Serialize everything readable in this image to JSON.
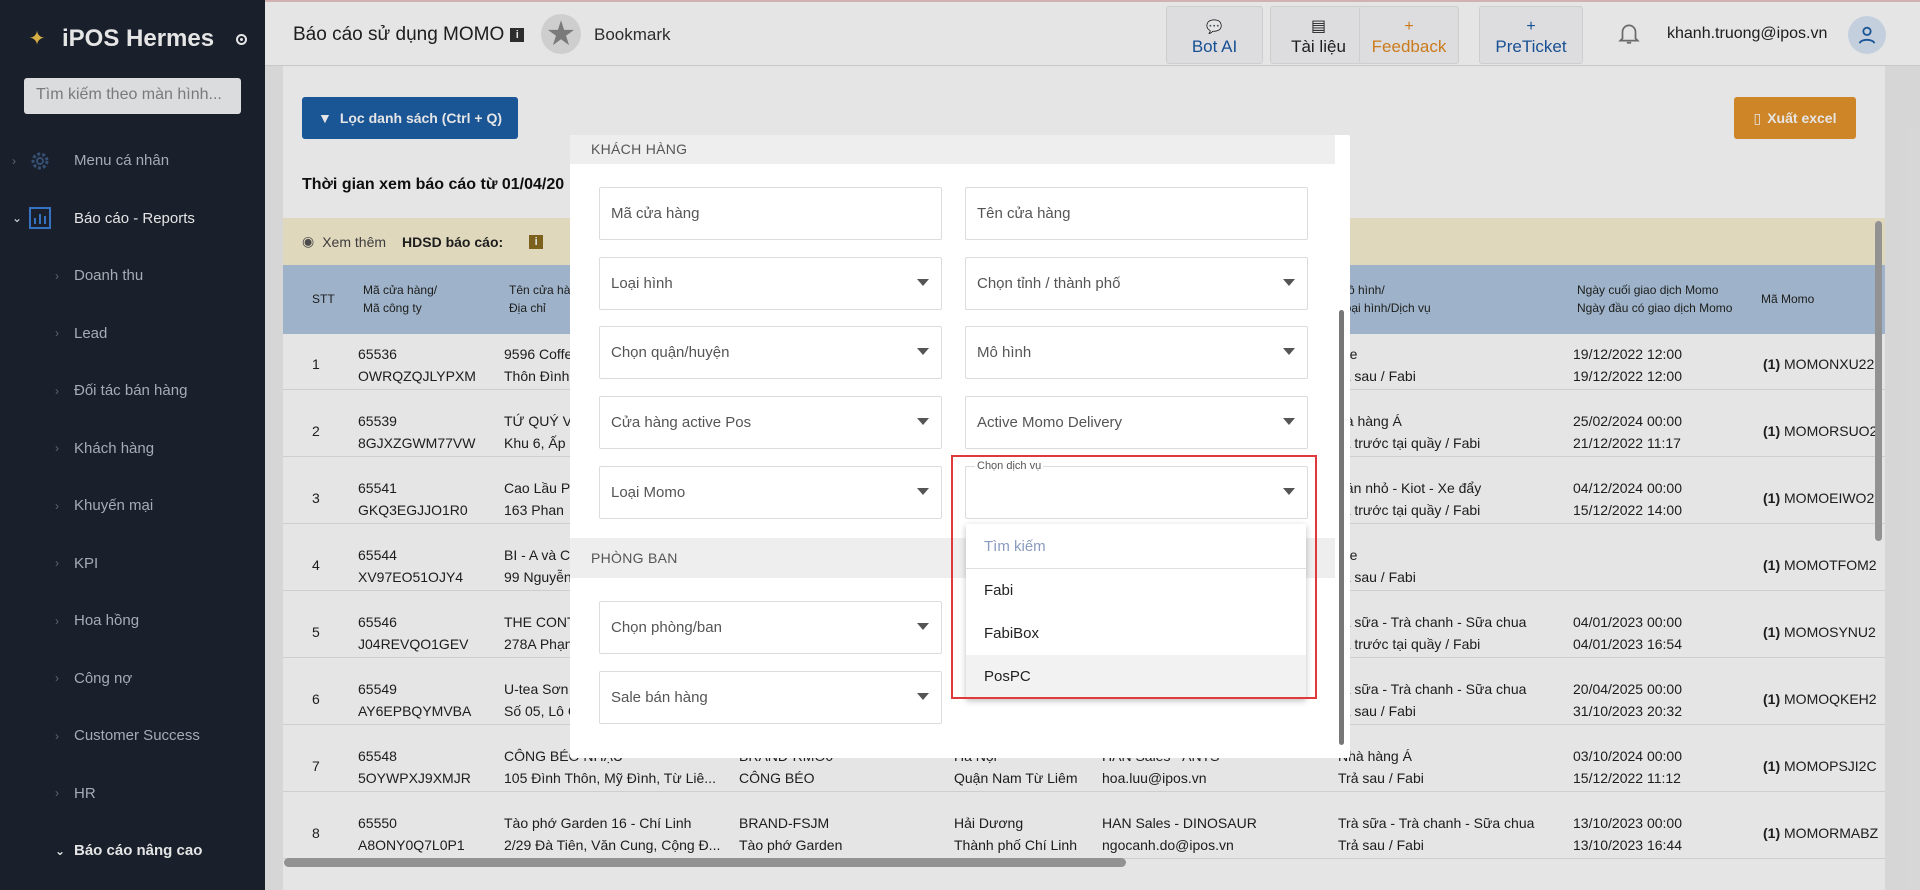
{
  "app": {
    "name": "iPOS Hermes"
  },
  "sidebar": {
    "search_placeholder": "Tìm kiếm theo màn hình...",
    "top_items": [
      {
        "label": "Menu cá nhân"
      },
      {
        "label": "Báo cáo - Reports"
      }
    ],
    "sub_items": [
      {
        "label": "Doanh thu"
      },
      {
        "label": "Lead"
      },
      {
        "label": "Đối tác bán hàng"
      },
      {
        "label": "Khách hàng"
      },
      {
        "label": "Khuyến mại"
      },
      {
        "label": "KPI"
      },
      {
        "label": "Hoa hồng"
      },
      {
        "label": "Công nợ"
      },
      {
        "label": "Customer Success"
      },
      {
        "label": "HR"
      },
      {
        "label": "Báo cáo nâng cao"
      }
    ]
  },
  "header": {
    "title": "Báo cáo sử dụng MOMO",
    "info_icon": "i",
    "bookmark_label": "Bookmark",
    "buttons": [
      {
        "label": "Bot AI",
        "icon": "chat-icon",
        "glyph": "💬"
      },
      {
        "label": "Tài liệu",
        "icon": "book-icon",
        "glyph": "📖"
      },
      {
        "label": "Feedback",
        "icon": "plus-icon",
        "glyph": "+"
      },
      {
        "label": "PreTicket",
        "icon": "plus-icon",
        "glyph": "+"
      }
    ],
    "user_email": "khanh.truong@ipos.vn"
  },
  "toolbar": {
    "filter_label": "Lọc danh sách (Ctrl + Q)",
    "export_label": "Xuất excel"
  },
  "report": {
    "time_text": "Thời gian xem báo cáo từ 01/04/20",
    "note_more": "Xem thêm",
    "note_guide": "HDSD báo cáo:",
    "note_icon": "i"
  },
  "table": {
    "columns": [
      {
        "line1": "STT",
        "line2": ""
      },
      {
        "line1": "Mã cửa hàng/",
        "line2": "Mã công ty"
      },
      {
        "line1": "Tên cửa hàn",
        "line2": "Địa chỉ"
      },
      {
        "line1": "Mô hình/",
        "line2": "Loại hình/Dịch vụ"
      },
      {
        "line1": "Ngày cuối giao dịch Momo",
        "line2": "Ngày đầu có giao dịch Momo"
      },
      {
        "line1": "Mã Momo",
        "line2": ""
      }
    ],
    "rows": [
      {
        "stt": "1",
        "code": "65536",
        "company": "OWRQZQJLYPXM",
        "name": "9596 Coffe",
        "address": "Thôn Đình",
        "brand": "",
        "brand_name": "",
        "city": "",
        "district": "",
        "sale": "",
        "sale_email": "",
        "model": "afe",
        "service": "rả sau / Fabi",
        "last": "19/12/2022 12:00",
        "first": "19/12/2022 12:00",
        "momo": "MOMONXU22"
      },
      {
        "stt": "2",
        "code": "65539",
        "company": "8GJXZGWM77VW",
        "name": "TỨ QUÝ VI",
        "address": "Khu 6, Ấp",
        "brand": "",
        "brand_name": "",
        "city": "",
        "district": "",
        "sale": "",
        "sale_email": "",
        "model": "hà hàng Á",
        "service": "rả trước tại quầy / Fabi",
        "last": "25/02/2024 00:00",
        "first": "21/12/2022 11:17",
        "momo": "MOMORSUO2"
      },
      {
        "stt": "3",
        "code": "65541",
        "company": "GKQ3EGJJO1R0",
        "name": "Cao Lầu P",
        "address": "163 Phan",
        "brand": "",
        "brand_name": "",
        "city": "",
        "district": "",
        "sale": "",
        "sale_email": "",
        "model": "uán nhỏ - Kiot - Xe đẩy",
        "service": "rả trước tại quầy / Fabi",
        "last": "04/12/2024 00:00",
        "first": "15/12/2022 14:00",
        "momo": "MOMOEIWO2"
      },
      {
        "stt": "4",
        "code": "65544",
        "company": "XV97EO51OJY4",
        "name": "BI - A và C",
        "address": "99 Nguyễn",
        "brand": "",
        "brand_name": "",
        "city": "",
        "district": "",
        "sale": "",
        "sale_email": "",
        "model": "afe",
        "service": "rả sau / Fabi",
        "last": "",
        "first": "",
        "momo": "MOMOTFOM2"
      },
      {
        "stt": "5",
        "code": "65546",
        "company": "J04REVQO1GEV",
        "name": "THE CONT",
        "address": "278A Phạn",
        "brand": "",
        "brand_name": "",
        "city": "",
        "district": "",
        "sale": "",
        "sale_email": "",
        "model": "rà sữa - Trà chanh - Sữa chua",
        "service": "rả trước tại quầy / Fabi",
        "last": "04/01/2023 00:00",
        "first": "04/01/2023 16:54",
        "momo": "MOMOSYNU2"
      },
      {
        "stt": "6",
        "code": "65549",
        "company": "AY6EPBQYMVBA",
        "name": "U-tea Sơn",
        "address": "Số 05, Lô C",
        "brand": "",
        "brand_name": "",
        "city": "",
        "district": "",
        "sale": "",
        "sale_email": "",
        "model": "rà sữa - Trà chanh - Sữa chua",
        "service": "rả sau / Fabi",
        "last": "20/04/2025 00:00",
        "first": "31/10/2023 20:32",
        "momo": "MOMOQKEH2"
      },
      {
        "stt": "7",
        "code": "65548",
        "company": "5OYWPXJ9XMJR",
        "name": "CÔNG BÉO NHẬU",
        "address": "105 Đình Thôn, Mỹ Đình, Từ Liê...",
        "brand": "BRAND-RMO0",
        "brand_name": "CÔNG BÉO",
        "city": "Hà Nội",
        "district": "Quận Nam Từ Liêm",
        "sale": "HAN Sales - ANTS",
        "sale_email": "hoa.luu@ipos.vn",
        "model": "Nhà hàng Á",
        "service": "Trả sau / Fabi",
        "last": "03/10/2024 00:00",
        "first": "15/12/2022 11:12",
        "momo": "MOMOPSJI2C"
      },
      {
        "stt": "8",
        "code": "65550",
        "company": "A8ONY0Q7L0P1",
        "name": "Tào phớ Garden 16 - Chí Linh",
        "address": "2/29 Đà Tiên, Văn Cung, Cộng Đ...",
        "brand": "BRAND-FSJM",
        "brand_name": "Tào phớ Garden",
        "city": "Hải Dương",
        "district": "Thành phố Chí Linh",
        "sale": "HAN Sales - DINOSAUR",
        "sale_email": "ngocanh.do@ipos.vn",
        "model": "Trà sữa - Trà chanh - Sữa chua",
        "service": "Trả sau / Fabi",
        "last": "13/10/2023 00:00",
        "first": "13/10/2023 16:44",
        "momo": "MOMORMABZ"
      }
    ],
    "momo_prefix": "(1)"
  },
  "modal": {
    "section_customer": "KHÁCH HÀNG",
    "section_department": "PHÒNG BAN",
    "fields": {
      "store_code": "Mã cửa hàng",
      "store_name": "Tên cửa hàng",
      "store_type": "Loại hình",
      "province": "Chọn tỉnh / thành phố",
      "district": "Chọn quận/huyện",
      "model": "Mô hình",
      "pos_active": "Cửa hàng active Pos",
      "momo_delivery": "Active Momo Delivery",
      "momo_type": "Loại Momo",
      "service_label": "Chọn dịch vụ",
      "department": "Chọn phòng/ban",
      "sale": "Sale bán hàng"
    },
    "dropdown": {
      "search_placeholder": "Tìm kiếm",
      "options": [
        "Fabi",
        "FabiBox",
        "PosPC"
      ]
    }
  },
  "colors": {
    "sidebar_bg": "#1c2330",
    "primary": "#1d5fa8",
    "accent_orange": "#e6952c",
    "highlight_red": "#e0393b",
    "table_header": "#b0c8e0"
  }
}
